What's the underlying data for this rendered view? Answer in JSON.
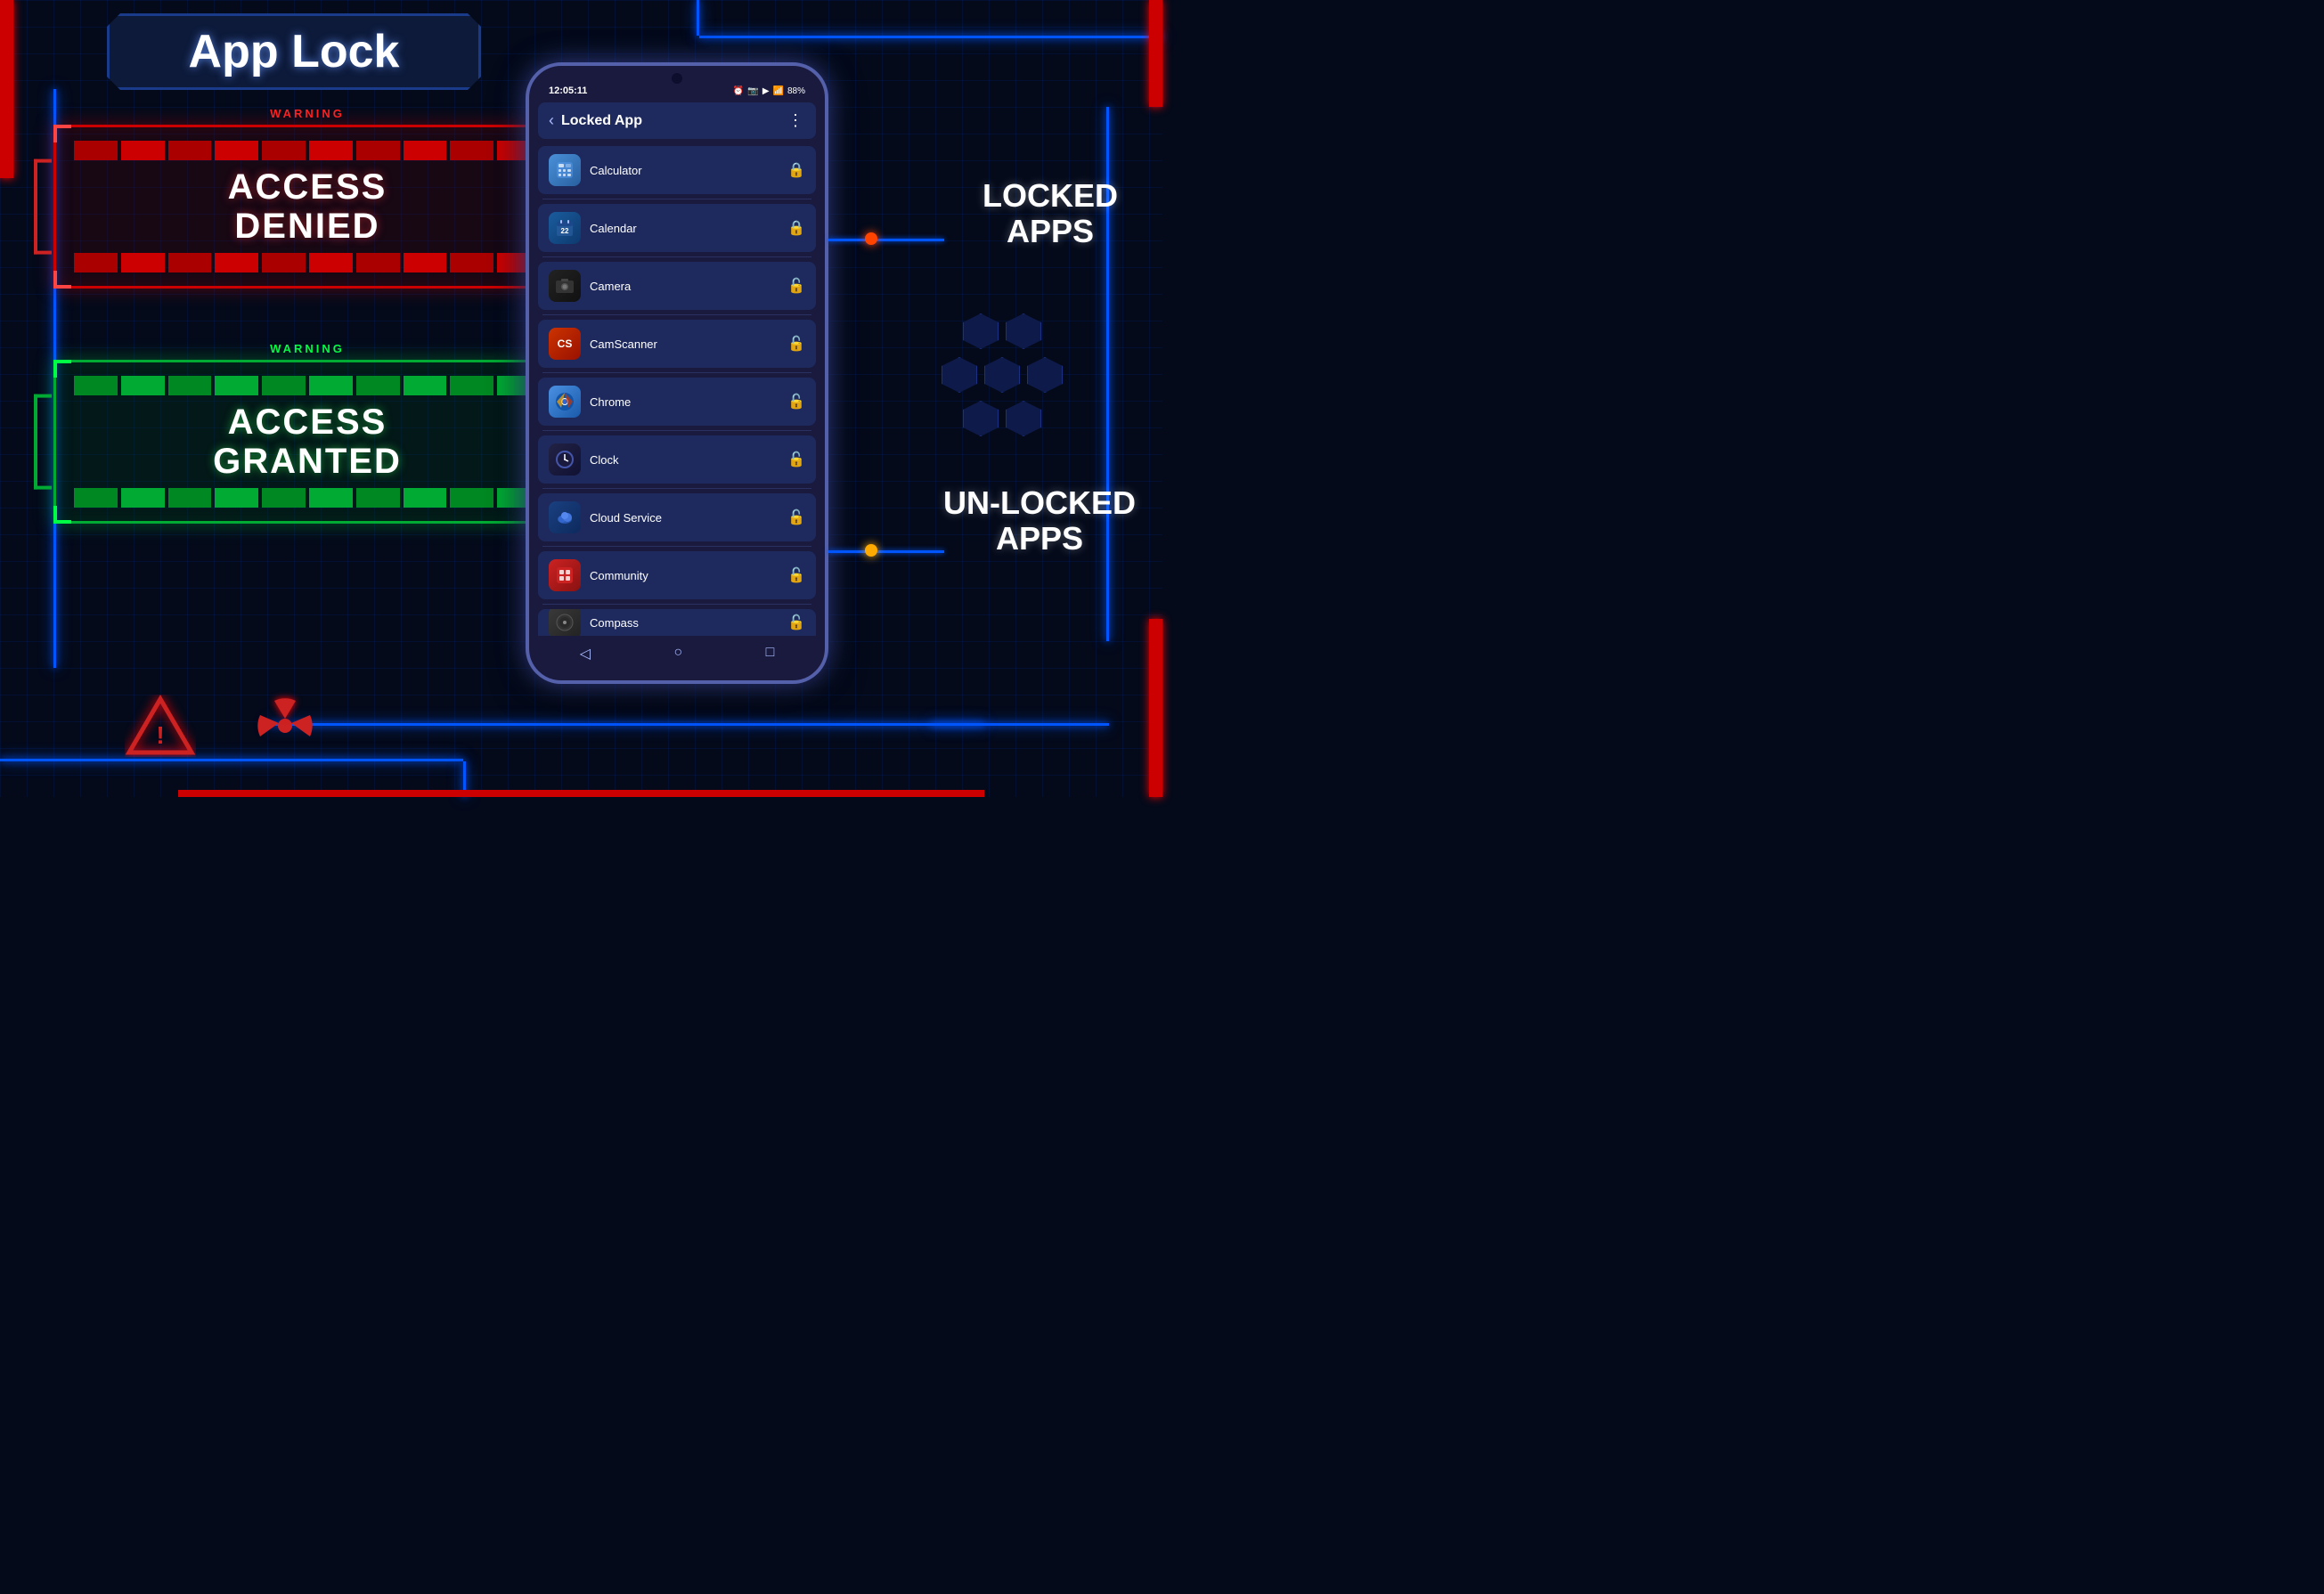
{
  "title": "App Lock",
  "header": {
    "title": "App Lock"
  },
  "access_denied": {
    "warning_label": "WARNING",
    "line1": "ACCESS",
    "line2": "DENIED"
  },
  "access_granted": {
    "warning_label": "WARNING",
    "line1": "ACCESS",
    "line2": "GRANTED"
  },
  "phone": {
    "status_time": "12:05:11",
    "battery": "88%",
    "screen_title": "Locked App",
    "apps": [
      {
        "name": "Calculator",
        "icon": "⊞",
        "locked": true,
        "icon_type": "calc"
      },
      {
        "name": "Calendar",
        "icon": "📅",
        "locked": true,
        "icon_type": "cal"
      },
      {
        "name": "Camera",
        "icon": "📷",
        "locked": false,
        "icon_type": "cam"
      },
      {
        "name": "CamScanner",
        "icon": "CS",
        "locked": false,
        "icon_type": "cs"
      },
      {
        "name": "Chrome",
        "icon": "◉",
        "locked": false,
        "icon_type": "chrome"
      },
      {
        "name": "Clock",
        "icon": "⏰",
        "locked": false,
        "icon_type": "clock"
      },
      {
        "name": "Cloud Service",
        "icon": "☁",
        "locked": false,
        "icon_type": "cloud"
      },
      {
        "name": "Community",
        "icon": "▣",
        "locked": false,
        "icon_type": "comm"
      },
      {
        "name": "Compass",
        "icon": "◎",
        "locked": false,
        "icon_type": "comp"
      }
    ]
  },
  "labels": {
    "locked_apps": "LOCKED\nAPPS",
    "unlocked_apps": "UN-LOCKED\nAPPS"
  }
}
